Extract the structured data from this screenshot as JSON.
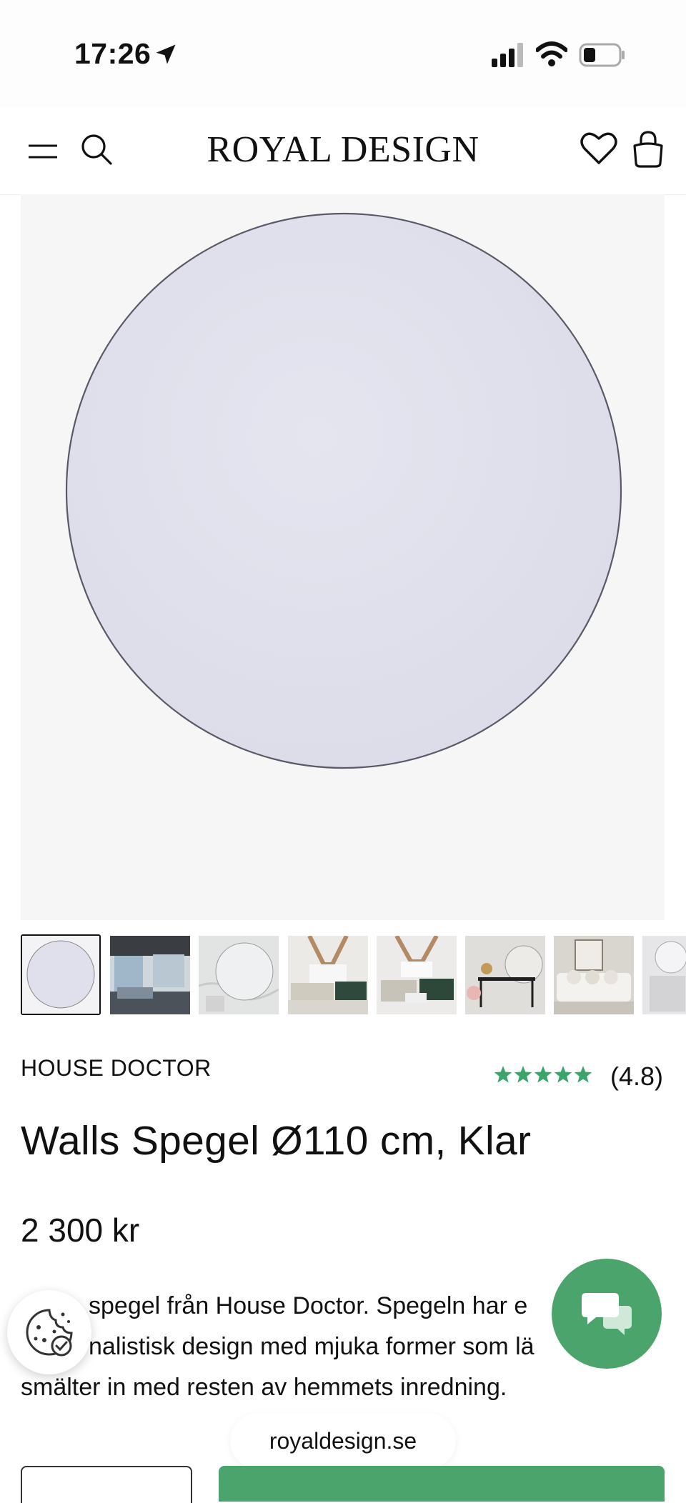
{
  "status_bar": {
    "time": "17:26"
  },
  "header": {
    "logo": "ROYAL DESIGN"
  },
  "gallery": {
    "thumbnails": [
      {
        "name": "thumb-mirror-front",
        "selected": true
      },
      {
        "name": "thumb-room-balcony"
      },
      {
        "name": "thumb-marble-wall"
      },
      {
        "name": "thumb-living-room-sofa"
      },
      {
        "name": "thumb-living-room-dining"
      },
      {
        "name": "thumb-console-table"
      },
      {
        "name": "thumb-white-sofa"
      },
      {
        "name": "thumb-partial"
      }
    ]
  },
  "product": {
    "brand": "HOUSE DOCTOR",
    "rating_value": 5,
    "rating_text": "(4.8)",
    "title": "Walls Spegel Ø110 cm, Klar",
    "price": "2 300 kr",
    "description_line1": "spegel från House Doctor. Spegeln har e",
    "description_line2": "nalistisk design med mjuka former som lä",
    "description_line3": "smälter in med resten av hemmets inredning."
  },
  "browser": {
    "url": "royaldesign.se"
  },
  "colors": {
    "accent": "#4aa46c",
    "star": "#3aa56b",
    "text": "#111111"
  }
}
